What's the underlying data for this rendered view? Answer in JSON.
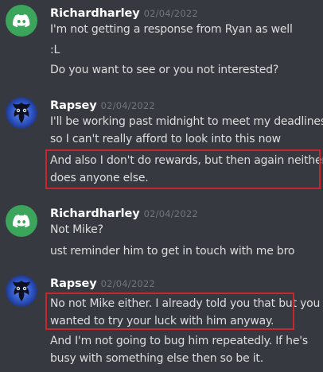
{
  "messages": [
    {
      "username": "Richardharley",
      "timestamp": "02/04/2022",
      "avatar_icon": "discord-logo-icon",
      "lines": [
        "I'm not getting a response from Ryan as well",
        ":L",
        "Do you want to see or you not interested?"
      ]
    },
    {
      "username": "Rapsey",
      "timestamp": "02/04/2022",
      "avatar_icon": "owl-avatar-icon",
      "lines": [
        "I'll be working past midnight to meet my deadlines",
        "so I can't really afford to look into this now",
        "And also I don't do rewards, but then again neither",
        "does anyone else."
      ]
    },
    {
      "username": "Richardharley",
      "timestamp": "02/04/2022",
      "avatar_icon": "discord-logo-icon",
      "lines": [
        "Not Mike?",
        "ust reminder him to get in touch with me bro"
      ]
    },
    {
      "username": "Rapsey",
      "timestamp": "02/04/2022",
      "avatar_icon": "owl-avatar-icon",
      "lines": [
        "No not Mike either. I already told you that but you",
        "wanted to try your luck with him anyway.",
        "And I'm not going to bug him repeatedly. If he's",
        "busy with something else then so be it."
      ]
    }
  ],
  "colors": {
    "background": "#36393f",
    "username": "#ffffff",
    "timestamp": "#72767d",
    "text": "#dcddde",
    "discord_avatar": "#3ba55c",
    "highlight_border": "#c9252c"
  }
}
